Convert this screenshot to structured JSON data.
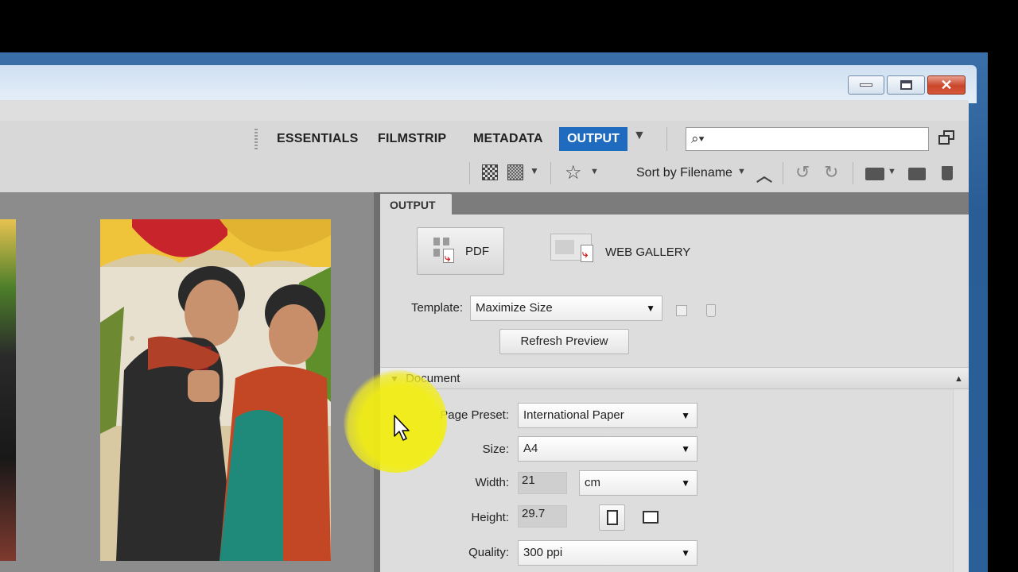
{
  "workspace_tabs": [
    "ESSENTIALS",
    "FILMSTRIP",
    "METADATA"
  ],
  "active_workspace": "OUTPUT",
  "search": {
    "placeholder": ""
  },
  "toolbar": {
    "sort_label": "Sort by Filename"
  },
  "panel": {
    "tab_label": "OUTPUT",
    "pdf_label": "PDF",
    "web_gallery_label": "WEB GALLERY",
    "template_label": "Template:",
    "template_value": "Maximize Size",
    "refresh_label": "Refresh Preview",
    "document_section": "Document",
    "fields": {
      "page_preset_label": "Page Preset:",
      "page_preset_value": "International Paper",
      "size_label": "Size:",
      "size_value": "A4",
      "width_label": "Width:",
      "width_value": "21",
      "unit_value": "cm",
      "height_label": "Height:",
      "height_value": "29.7",
      "quality_label": "Quality:",
      "quality_value": "300 ppi"
    }
  },
  "colors": {
    "active_tab": "#1f6bbf",
    "panel_bg": "#dddddd",
    "content_bg": "#8c8c8c",
    "close_button": "#c9452a"
  }
}
